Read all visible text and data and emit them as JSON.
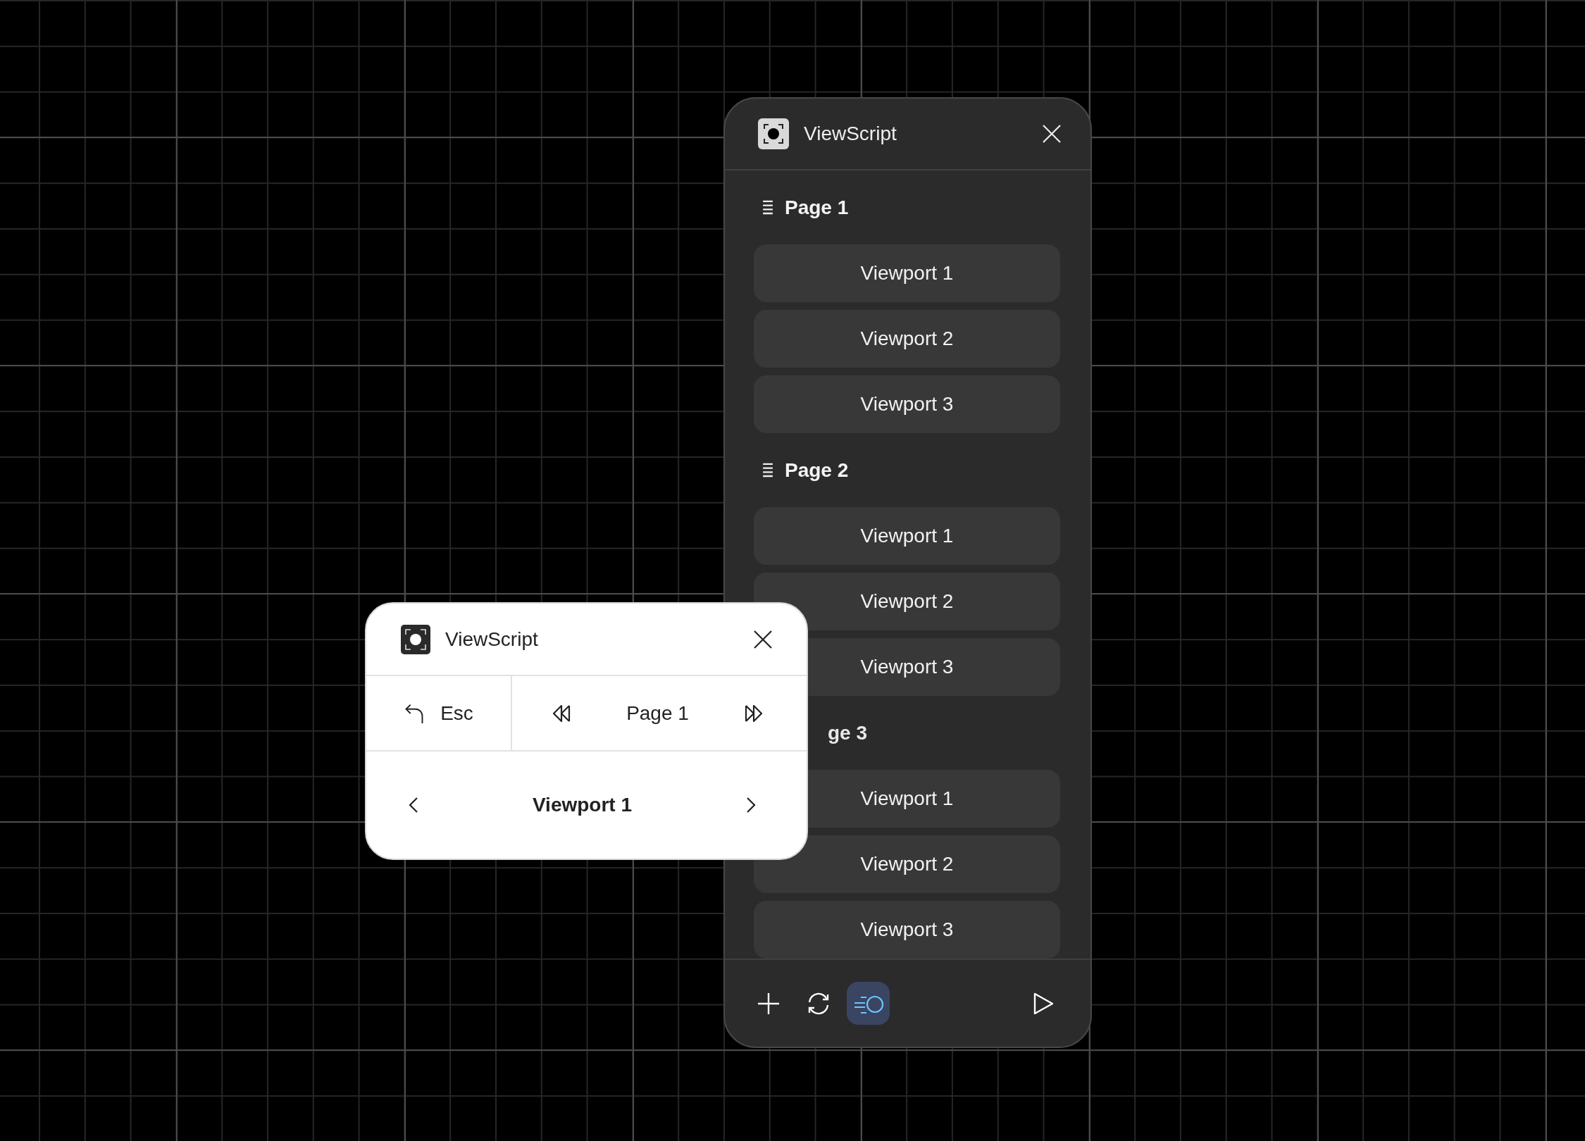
{
  "dark_panel": {
    "title": "ViewScript",
    "pages": [
      {
        "label": "Page 1",
        "partly_covered": false,
        "viewports": [
          "Viewport 1",
          "Viewport 2",
          "Viewport 3"
        ]
      },
      {
        "label": "Page 2",
        "partly_covered": false,
        "viewports": [
          "Viewport 1",
          "Viewport 2",
          "Viewport 3"
        ]
      },
      {
        "label": "ge 3",
        "partly_covered": true,
        "viewports": [
          "Viewport 1",
          "Viewport 2",
          "Viewport 3"
        ]
      }
    ],
    "toolbar": [
      {
        "kind": "add",
        "selected": false
      },
      {
        "kind": "refresh",
        "selected": false
      },
      {
        "kind": "motion",
        "selected": true
      },
      {
        "kind": "play",
        "selected": false
      }
    ]
  },
  "light_panel": {
    "title": "ViewScript",
    "back_label": "Esc",
    "page_label": "Page 1",
    "viewport_label": "Viewport 1"
  }
}
